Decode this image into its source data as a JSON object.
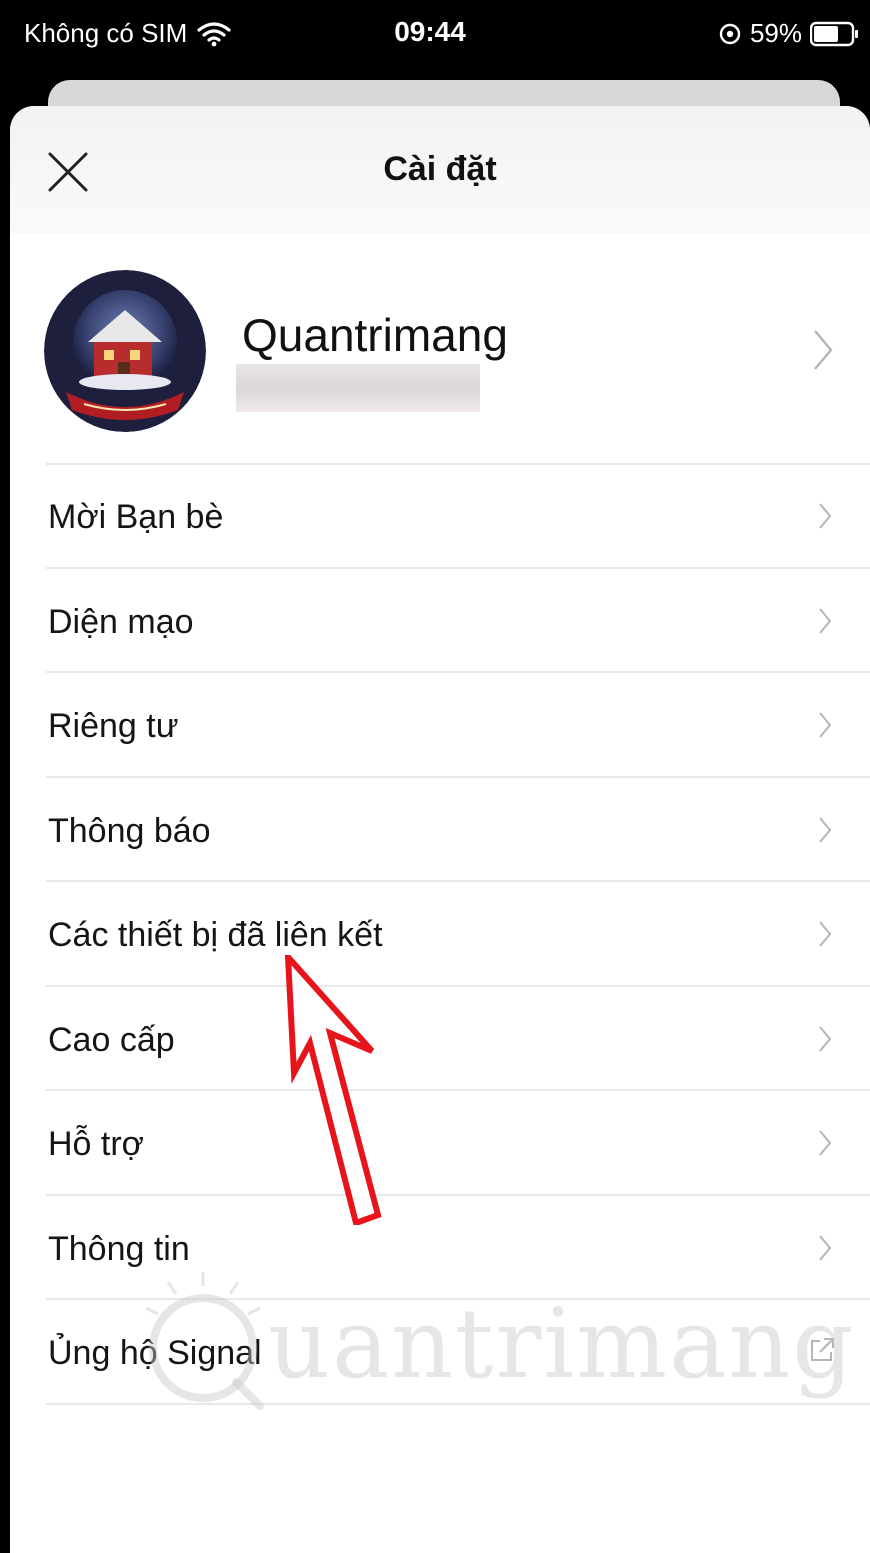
{
  "status_bar": {
    "carrier": "Không có SIM",
    "time": "09:44",
    "battery": "59%"
  },
  "header": {
    "title": "Cài đặt"
  },
  "profile": {
    "name": "Quantrimang"
  },
  "menu": {
    "items": [
      {
        "label": "Mời Bạn bè",
        "icon": "chevron-right-icon"
      },
      {
        "label": "Diện mạo",
        "icon": "chevron-right-icon"
      },
      {
        "label": "Riêng tư",
        "icon": "chevron-right-icon"
      },
      {
        "label": "Thông báo",
        "icon": "chevron-right-icon"
      },
      {
        "label": "Các thiết bị đã liên kết",
        "icon": "chevron-right-icon"
      },
      {
        "label": "Cao cấp",
        "icon": "chevron-right-icon"
      },
      {
        "label": "Hỗ trợ",
        "icon": "chevron-right-icon"
      },
      {
        "label": "Thông tin",
        "icon": "chevron-right-icon"
      },
      {
        "label": "Ủng hộ Signal",
        "icon": "external-link-icon"
      }
    ]
  },
  "watermark": {
    "text": "uantrimang"
  },
  "colors": {
    "annotation": "#e8141b",
    "background": "#000000",
    "sheet": "#ffffff"
  }
}
